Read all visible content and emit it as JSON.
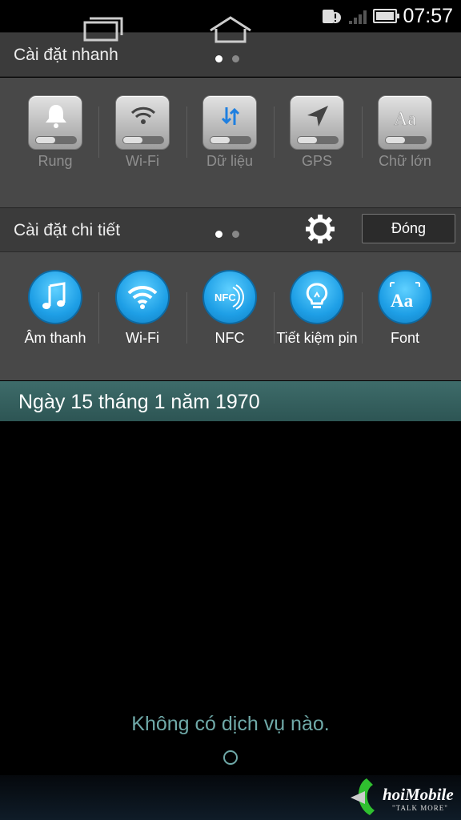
{
  "status_bar": {
    "time": "07:57"
  },
  "quick_settings": {
    "title": "Cài đặt nhanh",
    "page_dots": 2,
    "tiles": [
      {
        "label": "Rung",
        "icon": "bell-icon"
      },
      {
        "label": "Wi-Fi",
        "icon": "wifi-icon"
      },
      {
        "label": "Dữ liệu",
        "icon": "data-sync-icon"
      },
      {
        "label": "GPS",
        "icon": "gps-arrow-icon"
      },
      {
        "label": "Chữ lớn",
        "icon": "large-text-icon"
      }
    ]
  },
  "detail_settings": {
    "title": "Cài đặt chi tiết",
    "close_label": "Đóng",
    "tiles": [
      {
        "label": "Âm thanh",
        "icon": "music-note-icon"
      },
      {
        "label": "Wi-Fi",
        "icon": "wifi-icon"
      },
      {
        "label": "NFC",
        "icon": "nfc-icon"
      },
      {
        "label": "Tiết kiệm pin",
        "icon": "lightbulb-icon"
      },
      {
        "label": "Font",
        "icon": "font-icon"
      }
    ]
  },
  "date": "Ngày 15 tháng 1 năm 1970",
  "notification_empty": "Không có dịch vụ nào.",
  "watermark": {
    "brand": "hoiMobile",
    "tagline": "\"TALK MORE\""
  },
  "colors": {
    "accent_blue": "#1e9fe6",
    "date_bar": "#2d5554",
    "empty_text": "#6fa9a8"
  }
}
